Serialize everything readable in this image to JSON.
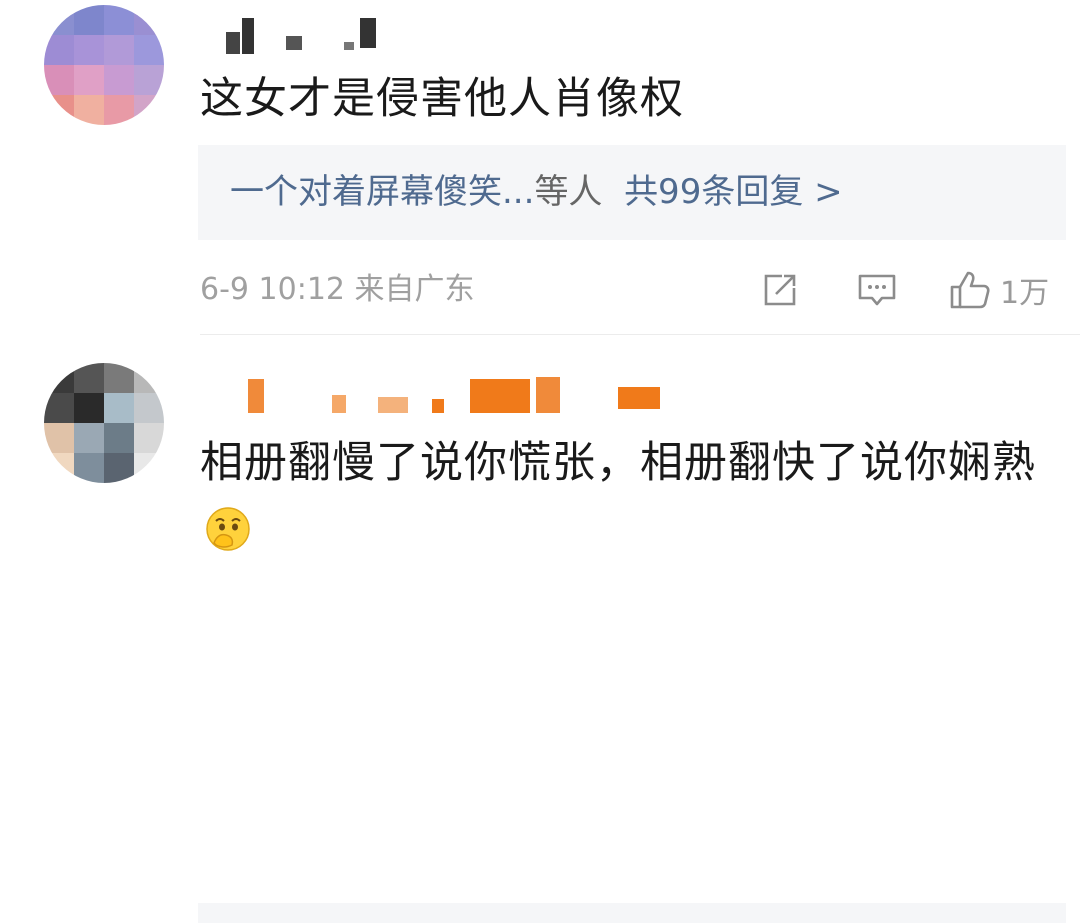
{
  "comments": [
    {
      "text": "这女才是侵害他人肖像权",
      "replies": {
        "names": "一个对着屏幕傻笑...",
        "suffix": "等人",
        "count_label": "共99条回复",
        "arrow": ">"
      },
      "meta": "6-9 10:12 来自广东",
      "icons": [
        "share-icon",
        "comment-icon",
        "like-icon"
      ],
      "likes": "1万"
    },
    {
      "text": "相册翻慢了说你慌张，相册翻快了说你娴熟",
      "emoji": "covering-mouth-face"
    }
  ],
  "colors": {
    "link": "#4f6a8f",
    "meta": "#a0a0a0",
    "reply_bg": "#f5f6f8",
    "username_redacted": "#f07a1a"
  }
}
